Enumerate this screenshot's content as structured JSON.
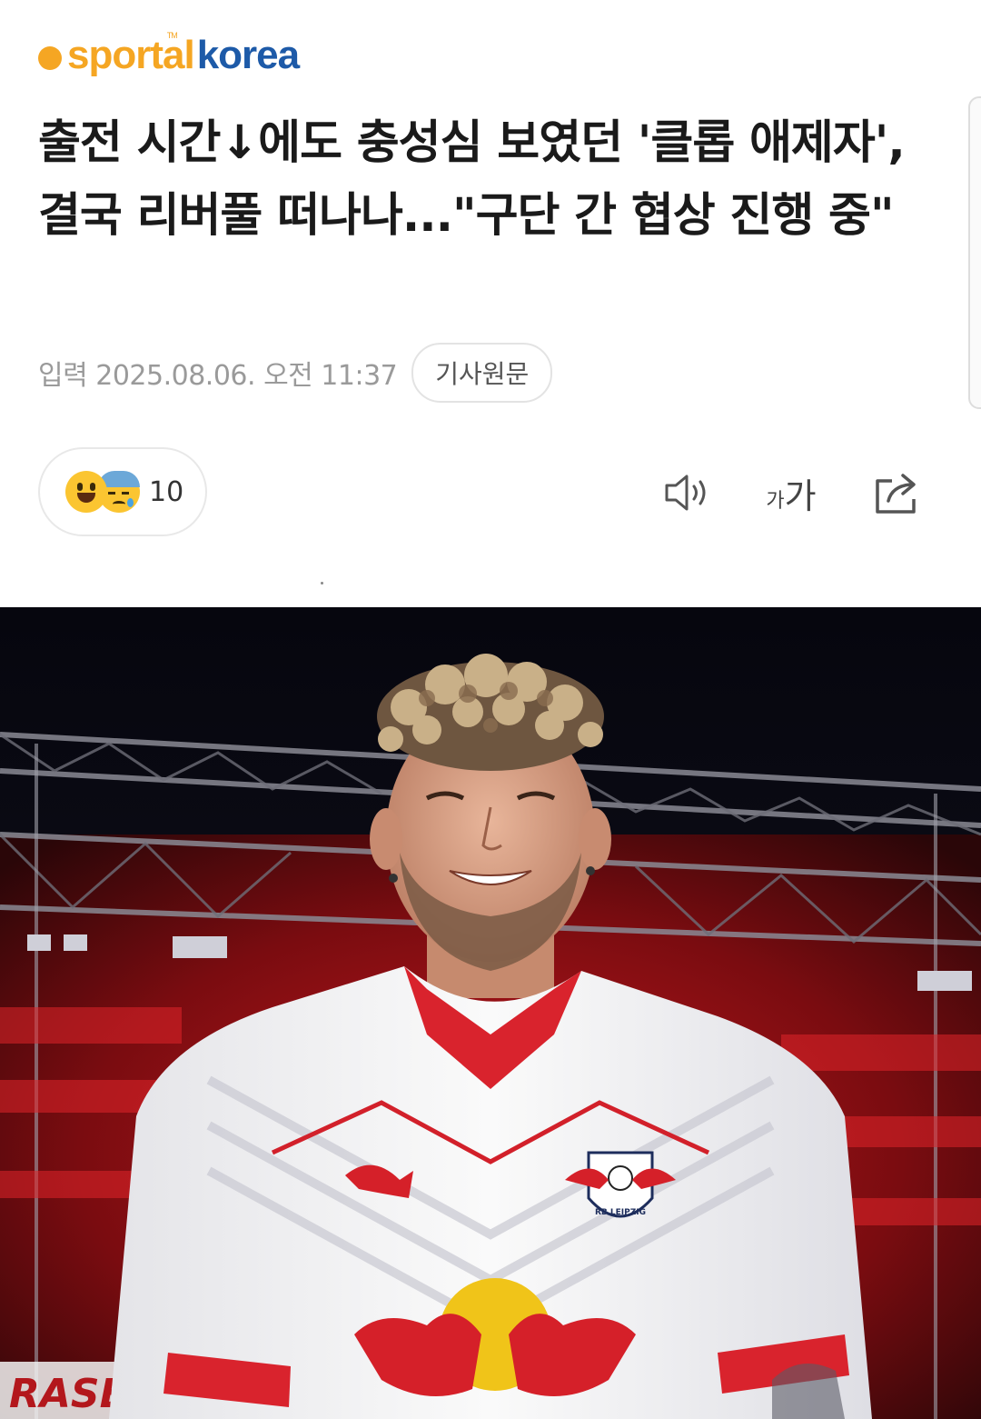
{
  "brand": {
    "logo_part1": "sportal",
    "logo_part2": "korea",
    "logo_tm": "TM",
    "colors": {
      "orange": "#f5a623",
      "blue": "#1d5aa8"
    }
  },
  "article": {
    "headline": "출전 시간↓에도 충성심 보였던 '클롭 애제자', 결국 리버풀 떠나나...\"구단 간 협상 진행 중\"",
    "published": "입력 2025.08.06. 오전 11:37",
    "original_link_label": "기사원문"
  },
  "reactions": {
    "icons": [
      "happy-emoji-icon",
      "sad-emoji-icon"
    ],
    "count": "10"
  },
  "toolbar": {
    "tts_icon": "speaker-icon",
    "font_small": "가",
    "font_large": "가",
    "share_icon": "share-icon"
  },
  "photo": {
    "jersey_text": "RB LEIPZIG",
    "banner_text": "RASE"
  }
}
